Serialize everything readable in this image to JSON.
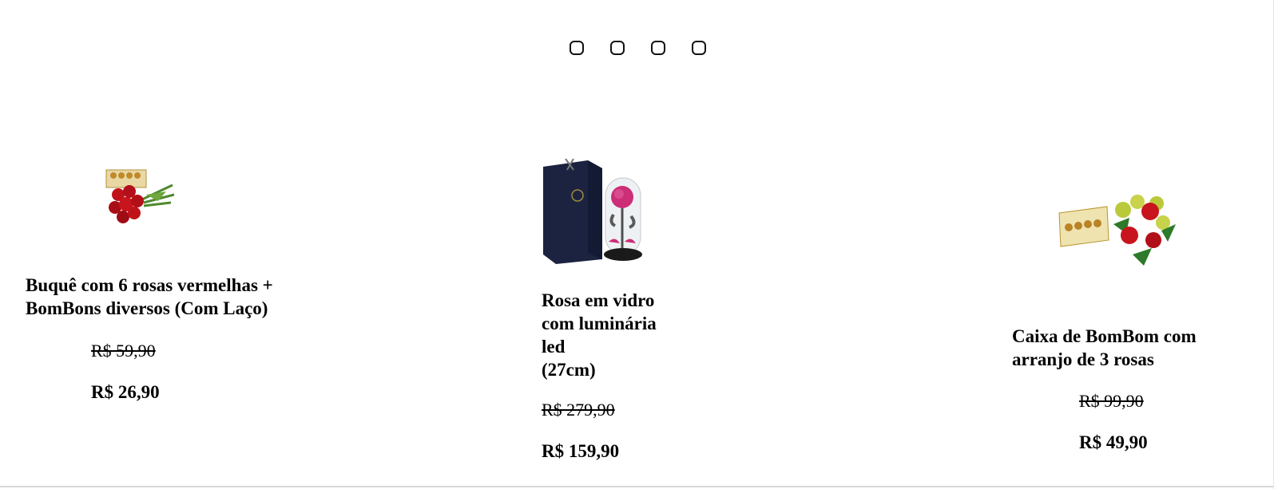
{
  "carousel": {
    "dots": [
      {
        "label": "slide-1"
      },
      {
        "label": "slide-2"
      },
      {
        "label": "slide-3"
      },
      {
        "label": "slide-4"
      }
    ]
  },
  "products": [
    {
      "title_lines": [
        "Buquê com 6 rosas vermelhas +",
        "BomBons diversos (Com Laço)"
      ],
      "old_price": "R$ 59,90",
      "price": "R$ 26,90",
      "image": "bouquet-with-chocolates"
    },
    {
      "title_lines": [
        "Rosa em vidro",
        "com luminária",
        "led",
        "(27cm)"
      ],
      "old_price": "R$ 279,90",
      "price": "R$ 159,90",
      "image": "glass-dome-rose-with-box"
    },
    {
      "title_lines": [
        "Caixa de BomBom com",
        "arranjo de 3 rosas"
      ],
      "old_price": "R$ 99,90",
      "price": "R$ 49,90",
      "image": "chocolate-box-with-roses"
    }
  ]
}
